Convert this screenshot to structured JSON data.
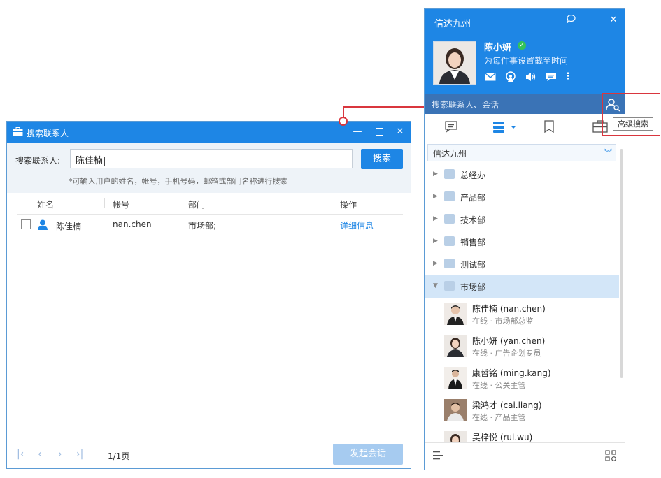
{
  "dialog": {
    "title": "搜索联系人",
    "search_label": "搜索联系人:",
    "search_value": "陈佳楠",
    "search_button": "搜索",
    "hint": "*可输入用户的姓名，帐号，手机号码，邮箱或部门名称进行搜索",
    "columns": [
      "姓名",
      "帐号",
      "部门",
      "操作"
    ],
    "rows": [
      {
        "name": "陈佳楠",
        "account": "nan.chen",
        "dept": "市场部;",
        "action": "详细信息"
      }
    ],
    "page": "1/1页",
    "start_chat": "发起会话"
  },
  "im": {
    "app_title": "信达九州",
    "user_name": "陈小妍",
    "signature": "为每件事设置截至时间",
    "search_placeholder": "搜索联系人、会话",
    "tooltip": "高级搜索",
    "org": "信达九州",
    "depts": [
      {
        "name": "总经办",
        "expanded": false
      },
      {
        "name": "产品部",
        "expanded": false
      },
      {
        "name": "技术部",
        "expanded": false
      },
      {
        "name": "销售部",
        "expanded": false
      },
      {
        "name": "测试部",
        "expanded": false
      },
      {
        "name": "市场部",
        "expanded": true
      }
    ],
    "members": [
      {
        "name": "陈佳楠 (nan.chen)",
        "status": "在线 · 市场部总监"
      },
      {
        "name": "陈小妍 (yan.chen)",
        "status": "在线 · 广告企划专员"
      },
      {
        "name": "康哲铭 (ming.kang)",
        "status": "在线 · 公关主管"
      },
      {
        "name": "梁鸿才 (cai.liang)",
        "status": "在线 · 产品主管"
      },
      {
        "name": "吴梓悦 (rui.wu)",
        "status": ""
      }
    ]
  },
  "icons": [
    "briefcase-icon",
    "minimize-icon",
    "maximize-icon",
    "close-icon",
    "user-icon",
    "first-page-icon",
    "prev-page-icon",
    "next-page-icon",
    "last-page-icon",
    "chat-bubble-icon",
    "verified-icon",
    "mail-icon",
    "broadcast-icon",
    "speaker-icon",
    "message-icon",
    "more-icon",
    "advanced-search-icon",
    "recent-chats-icon",
    "contacts-icon",
    "bookmark-icon",
    "work-icon",
    "menu-icon",
    "apps-icon"
  ],
  "colors": {
    "accent": "#1e86e5",
    "highlight": "#d9363e",
    "selected_row": "#d3e6f8",
    "online": "#33c35a"
  }
}
